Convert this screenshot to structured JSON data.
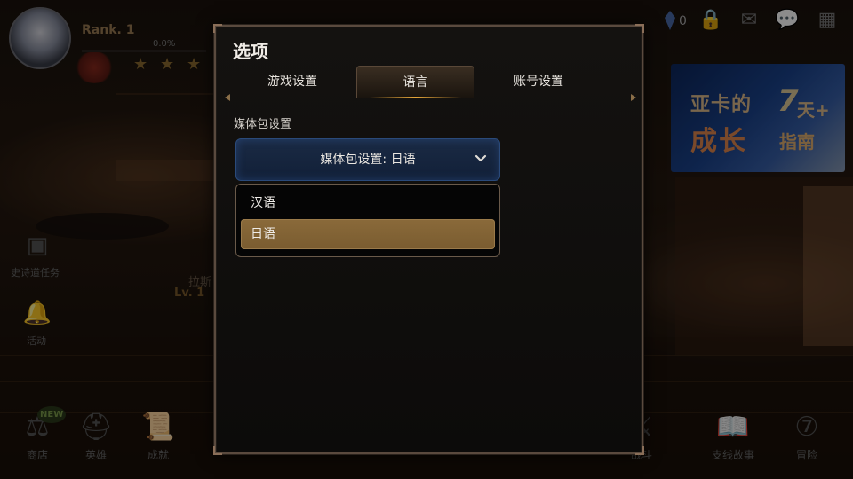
{
  "hud": {
    "rank": "Rank. 1",
    "xp": "0.0%",
    "gem_count": "0"
  },
  "left_menu": {
    "epic_quest": "史诗道任务",
    "activity": "活动",
    "hero_name": "拉斯",
    "hero_level": "Lv. 1"
  },
  "bottom_nav": {
    "shop": "商店",
    "new_badge": "NEW",
    "heroes": "英雄",
    "achievements": "成就",
    "battle": "战斗",
    "side_story": "支线故事",
    "adventure": "冒险"
  },
  "promo": {
    "line1": "亚卡的",
    "number": "7",
    "day": "天+",
    "line2": "成长",
    "guide": "指南"
  },
  "modal": {
    "title": "选项",
    "tabs": {
      "game_settings": "游戏设置",
      "language": "语言",
      "account_settings": "账号设置"
    },
    "active_tab": "language",
    "section_label": "媒体包设置",
    "dropdown": {
      "value_text": "媒体包设置: 日语",
      "options": [
        "汉语",
        "日语"
      ],
      "selected": "日语"
    }
  },
  "colors": {
    "accent_gold": "#e8a83a",
    "selected_option": "#8a6a3a",
    "dropdown_blue": "#1a2a44"
  }
}
